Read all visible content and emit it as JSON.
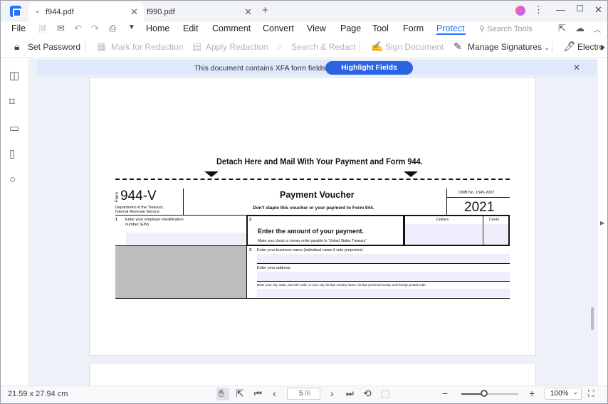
{
  "tabs": [
    {
      "label": "f944.pdf",
      "active": true
    },
    {
      "label": "f990.pdf",
      "active": false
    }
  ],
  "menu": {
    "file": "File",
    "items": [
      "Home",
      "Edit",
      "Comment",
      "Convert",
      "View",
      "Page",
      "Tool",
      "Form",
      "Protect"
    ],
    "active": "Protect",
    "search_placeholder": "Search Tools"
  },
  "toolbar": {
    "set_password": "Set Password",
    "mark_for_redaction": "Mark for Redaction",
    "apply_redaction": "Apply Redaction",
    "search_redact": "Search & Redact",
    "sign_document": "Sign Document",
    "manage_signatures": "Manage Signatures",
    "electronic": "Electro"
  },
  "banner": {
    "message": "This document contains XFA form fields.",
    "button": "Highlight Fields"
  },
  "form": {
    "detach": "Detach Here and Mail With Your Payment and Form 944.",
    "form_word": "Form",
    "form_number": "944-V",
    "dept": "Department of the Treasury",
    "irs": "Internal Revenue Service",
    "title": "Payment Voucher",
    "subtitle": "Don't staple this voucher or your payment to Form 944.",
    "omb": "OMB No. 1545-2007",
    "year": "2021",
    "line1_num": "1",
    "line1_text_a": "Enter your employer identification",
    "line1_text_b": "number (EIN).",
    "line2_num": "2",
    "line2_title": "Enter the amount of your payment.",
    "line2_sub": "Make your check or money order payable to “United States Treasury”",
    "dollars": "Dollars",
    "cents": "Cents",
    "line3_num": "3",
    "line3_name": "Enter your business name (individual name if sole proprietor).",
    "line3_address": "Enter your address.",
    "line3_city": "Enter your city, state, and ZIP code; or your city, foreign country name, foreign province/county, and foreign postal code."
  },
  "status": {
    "dimensions": "21.59 x 27.94 cm",
    "current_page": "5",
    "total_pages": "/6",
    "zoom": "100%",
    "zoom_value": 0.4
  }
}
